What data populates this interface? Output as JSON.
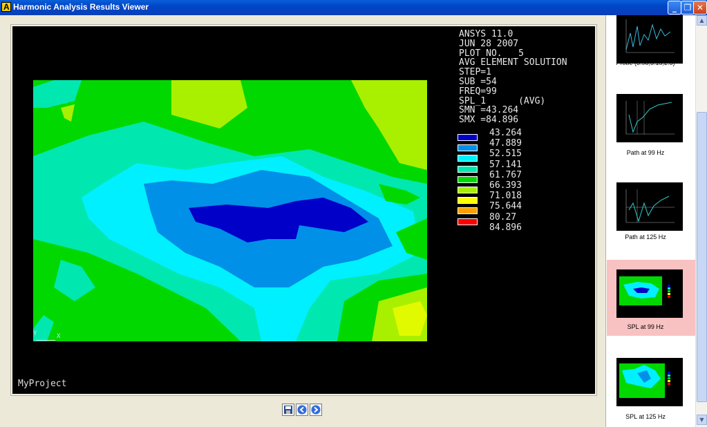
{
  "window": {
    "title": "Harmonic Analysis Results Viewer",
    "minimize": "_",
    "maximize": "❐",
    "close": "✕"
  },
  "plot": {
    "info_lines": [
      "ANSYS 11.0",
      "JUN 28 2007",
      "PLOT NO.   5",
      "AVG ELEMENT SOLUTION",
      "STEP=1",
      "SUB =54",
      "FREQ=99",
      "SPL_1      (AVG)",
      "SMN =43.264",
      "SMX =84.896"
    ],
    "legend": [
      {
        "value": "43.264",
        "color": "#0000c8"
      },
      {
        "value": "47.889",
        "color": "#0090e8"
      },
      {
        "value": "52.515",
        "color": "#00f0ff"
      },
      {
        "value": "57.141",
        "color": "#00e8b0"
      },
      {
        "value": "61.767",
        "color": "#00d800"
      },
      {
        "value": "66.393",
        "color": "#a8f000"
      },
      {
        "value": "71.018",
        "color": "#ffff00"
      },
      {
        "value": "75.644",
        "color": "#ffa000"
      },
      {
        "value": "80.27",
        "color": "#ff0000"
      },
      {
        "value": "84.896",
        "color": ""
      }
    ],
    "project": "MyProject",
    "triad_y": "Y",
    "triad_x": "X"
  },
  "toolbar": {
    "save": "save-icon",
    "back": "back-arrow-icon",
    "forward": "forward-arrow-icon"
  },
  "thumbnails": [
    {
      "label": "Probe (3.98,3.15,2.5)"
    },
    {
      "label": "Path at 99 Hz"
    },
    {
      "label": "Path at 125 Hz"
    },
    {
      "label": "SPL at 99 Hz",
      "selected": true
    },
    {
      "label": "SPL at 125 Hz"
    }
  ],
  "colors": {
    "titlebar": "#0a4fd0",
    "selection": "#f9c2c2",
    "plot_bg": "#000000"
  }
}
